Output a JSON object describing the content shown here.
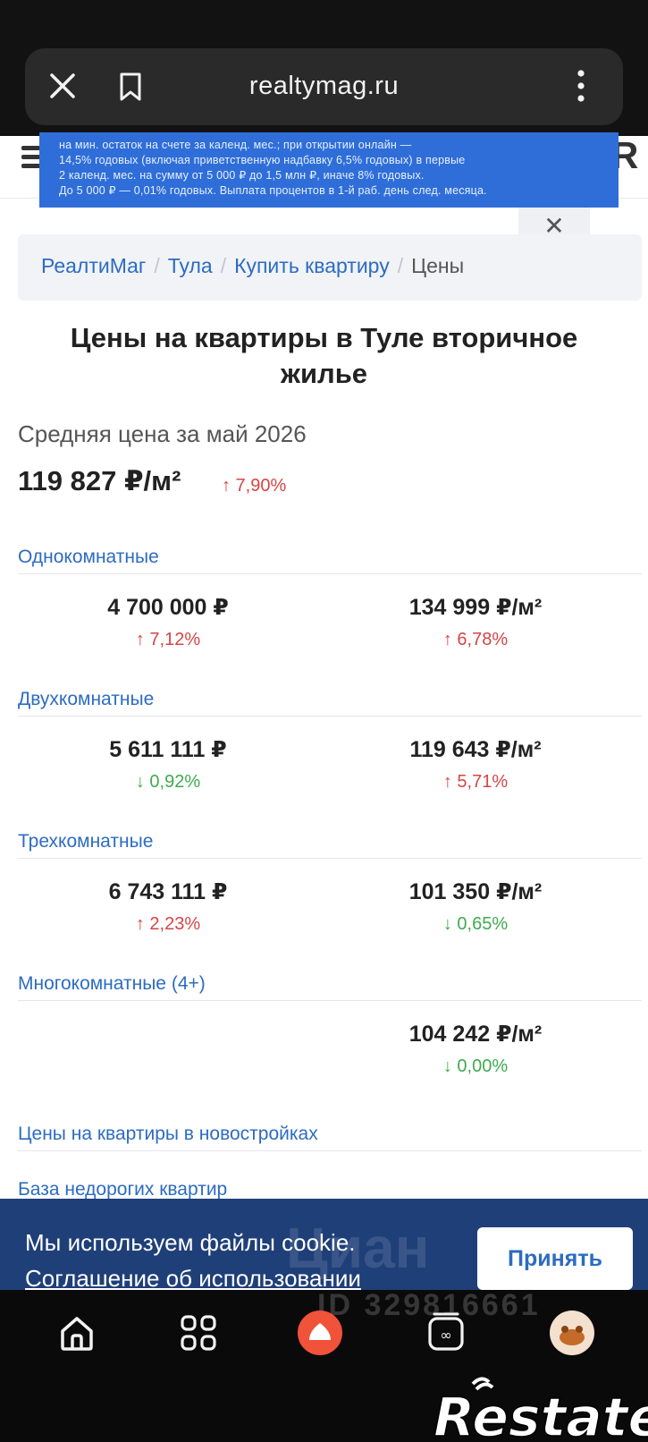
{
  "browser": {
    "url": "realtymag.ru"
  },
  "ad": {
    "lines": [
      "на мин. остаток на счете за календ. мес.; при открытии онлайн —",
      "14,5% годовых (включая приветственную надбавку 6,5% годовых) в первые",
      "2 календ. мес. на сумму от 5 000 ₽ до 1,5 млн ₽, иначе 8% годовых.",
      "До 5 000 ₽ — 0,01% годовых. Выплата процентов в 1-й раб. день след. месяца."
    ],
    "close_label": "✕"
  },
  "breadcrumb": {
    "items": [
      "РеалтиМаг",
      "Тула",
      "Купить квартиру"
    ],
    "current": "Цены",
    "separator": "/"
  },
  "page": {
    "title": "Цены на квартиры в Туле вторичное жилье",
    "avg_label": "Средняя цена за май 2026",
    "avg_value": "119 827 ₽/м²",
    "avg_change": "↑ 7,90%"
  },
  "sections": [
    {
      "name": "Однокомнатные",
      "price": "4 700 000 ₽",
      "price_change": "↑ 7,12%",
      "per_m2": "134 999 ₽/м²",
      "per_m2_change": "↑ 6,78%"
    },
    {
      "name": "Двухкомнатные",
      "price": "5 611 111 ₽",
      "price_change": "↓ 0,92%",
      "per_m2": "119 643 ₽/м²",
      "per_m2_change": "↑ 5,71%"
    },
    {
      "name": "Трехкомнатные",
      "price": "6 743 111 ₽",
      "price_change": "↑ 2,23%",
      "per_m2": "101 350 ₽/м²",
      "per_m2_change": "↓ 0,65%"
    },
    {
      "name": "Многокомнатные (4+)",
      "price": "",
      "price_change": "",
      "per_m2": "104 242 ₽/м²",
      "per_m2_change": "↓ 0,00%"
    }
  ],
  "links": {
    "new_buildings": "Цены на квартиры в новостройках",
    "cheap_base": "База недорогих квартир"
  },
  "cookie": {
    "text": "Мы используем файлы cookie.",
    "link": "Соглашение об использовании",
    "accept": "Принять"
  },
  "watermark": {
    "id": "ID 329816661",
    "logo": "Циан"
  },
  "footer_logo": "Restate",
  "colors": {
    "link": "#2d6cc0",
    "up": "#d64545",
    "down": "#3faa4f",
    "cookie_bg": "#1f3f78",
    "ad_bg": "#2f6ed8"
  },
  "icons": [
    "close-icon",
    "bookmark-icon",
    "more-vert-icon",
    "home-icon",
    "apps-icon",
    "alice-icon",
    "tabs-icon",
    "profile-icon"
  ]
}
